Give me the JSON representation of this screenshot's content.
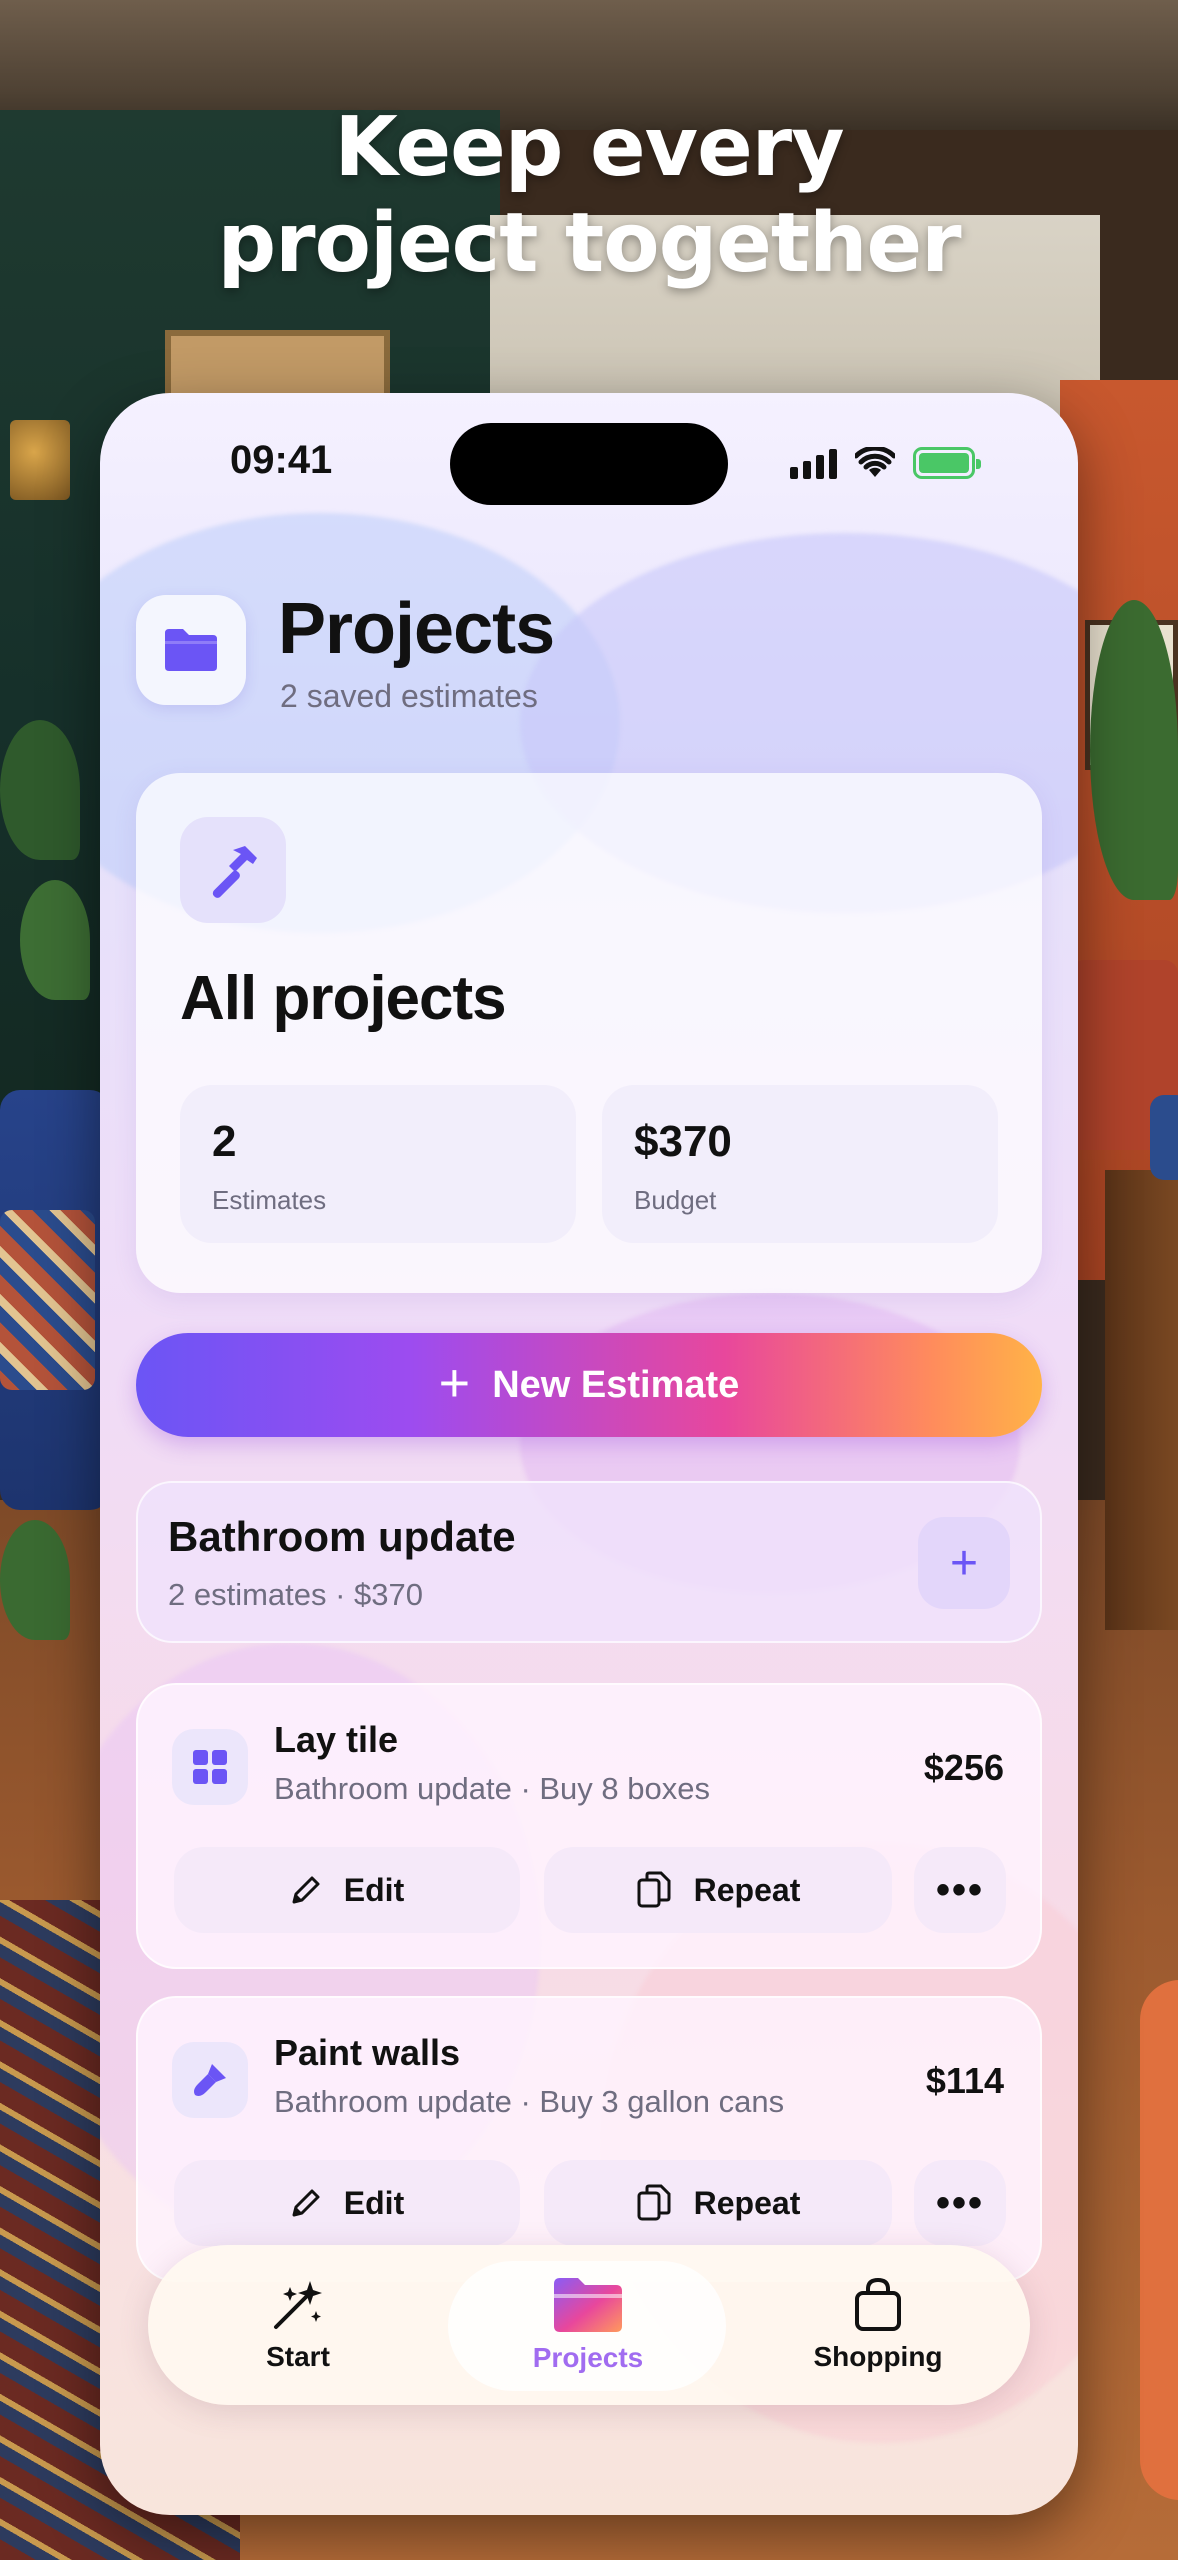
{
  "headline": {
    "line1": "Keep every",
    "line2": "project together"
  },
  "status_bar": {
    "time": "09:41",
    "icons": [
      "signal-icon",
      "wifi-icon",
      "battery-charging-icon"
    ]
  },
  "header": {
    "icon": "folder-icon",
    "title": "Projects",
    "subtitle": "2 saved estimates"
  },
  "summary": {
    "icon": "hammer-icon",
    "title": "All projects",
    "stats": [
      {
        "value": "2",
        "label": "Estimates"
      },
      {
        "value": "$370",
        "label": "Budget"
      }
    ]
  },
  "new_estimate": {
    "label": "New Estimate",
    "icon": "plus-icon",
    "gradient": [
      "#6b55f5",
      "#9c4cf0",
      "#e8479c",
      "#ff8c5c",
      "#ffb347"
    ]
  },
  "group": {
    "title": "Bathroom update",
    "subtitle": "2 estimates · $370",
    "add_icon": "plus-icon"
  },
  "estimates": [
    {
      "icon": "tile-grid-icon",
      "title": "Lay tile",
      "subtitle": "Bathroom update · Buy 8 boxes",
      "price": "$256",
      "edit_label": "Edit",
      "repeat_label": "Repeat",
      "more_label": "•••"
    },
    {
      "icon": "paint-brush-icon",
      "title": "Paint walls",
      "subtitle": "Bathroom update · Buy 3 gallon cans",
      "price": "$114",
      "edit_label": "Edit",
      "repeat_label": "Repeat",
      "more_label": "•••"
    }
  ],
  "tabbar": {
    "tabs": [
      {
        "label": "Start",
        "icon": "sparkles-icon",
        "active": false
      },
      {
        "label": "Projects",
        "icon": "folder-icon",
        "active": true
      },
      {
        "label": "Shopping",
        "icon": "shopping-bag-icon",
        "active": false
      }
    ]
  },
  "colors": {
    "accent": "#6b55f5",
    "active_tab": "#a16cf0",
    "battery": "#4ac766"
  }
}
